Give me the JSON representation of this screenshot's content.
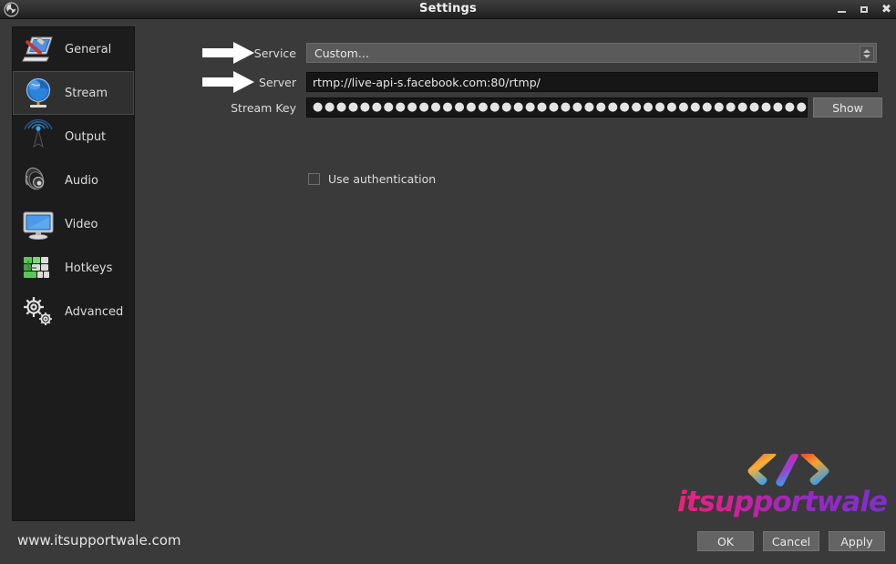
{
  "window": {
    "title": "Settings",
    "app_icon": "obs-logo-icon",
    "controls": {
      "minimize": "minimize-icon",
      "maximize": "maximize-icon",
      "close": "close-icon"
    }
  },
  "sidebar": {
    "items": [
      {
        "label": "General",
        "icon": "general-icon",
        "selected": false
      },
      {
        "label": "Stream",
        "icon": "stream-icon",
        "selected": true
      },
      {
        "label": "Output",
        "icon": "output-icon",
        "selected": false
      },
      {
        "label": "Audio",
        "icon": "audio-icon",
        "selected": false
      },
      {
        "label": "Video",
        "icon": "video-icon",
        "selected": false
      },
      {
        "label": "Hotkeys",
        "icon": "hotkeys-icon",
        "selected": false
      },
      {
        "label": "Advanced",
        "icon": "advanced-icon",
        "selected": false
      }
    ]
  },
  "stream_settings": {
    "service": {
      "label": "Service",
      "value": "Custom...",
      "annotated": true
    },
    "server": {
      "label": "Server",
      "value": "rtmp://live-api-s.facebook.com:80/rtmp/",
      "annotated": true
    },
    "stream_key": {
      "label": "Stream Key",
      "value": "●●●●●●●●●●●●●●●●●●●●●●●●●●●●●●●●●●●●●●●●●●●●●●●●",
      "show_button": "Show",
      "masked": true
    },
    "use_authentication": {
      "label": "Use authentication",
      "checked": false
    }
  },
  "footer": {
    "site_url": "www.itsupportwale.com",
    "buttons": [
      {
        "label": "OK"
      },
      {
        "label": "Cancel"
      },
      {
        "label": "Apply"
      }
    ]
  },
  "watermark": {
    "brand": "itsupportwale",
    "icon": "code-brackets-icon"
  }
}
